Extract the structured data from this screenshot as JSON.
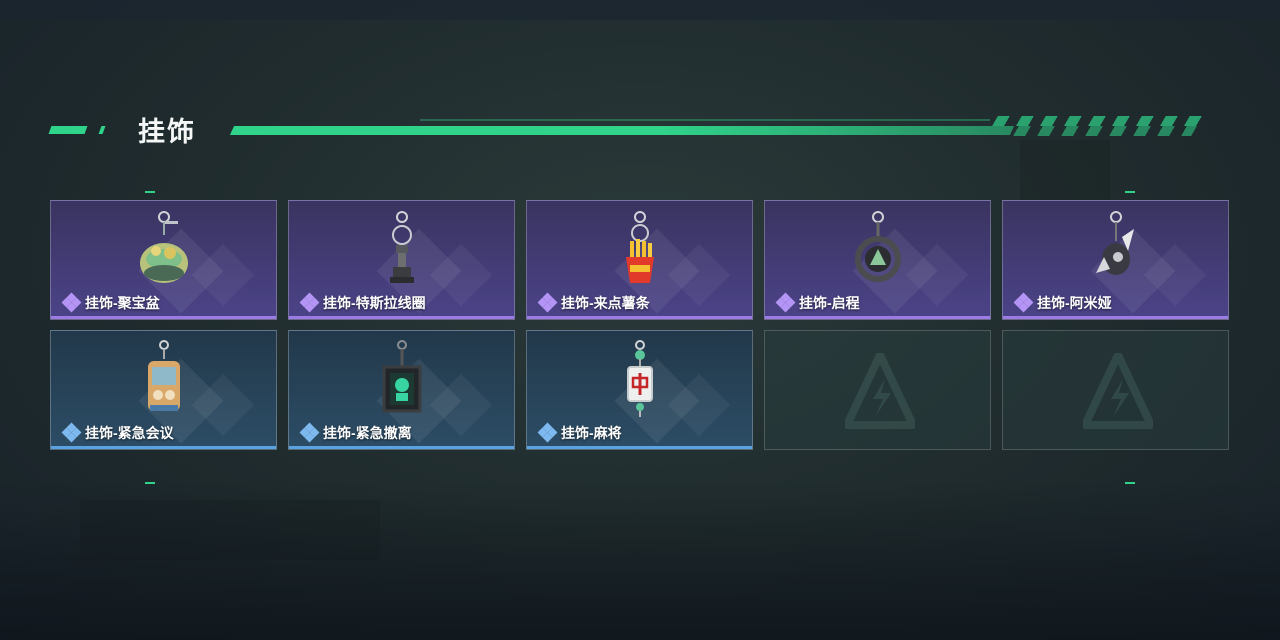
{
  "header": {
    "title": "挂饰"
  },
  "colors": {
    "accent": "#2fd48a",
    "purple_rarity": "#9b7be4",
    "blue_rarity": "#5aa3e0"
  },
  "items": [
    {
      "label": "挂饰-聚宝盆",
      "rarity": "purple",
      "icon": "treasure-bowl-charm-icon"
    },
    {
      "label": "挂饰-特斯拉线圈",
      "rarity": "purple",
      "icon": "tesla-coil-charm-icon"
    },
    {
      "label": "挂饰-来点薯条",
      "rarity": "purple",
      "icon": "fries-charm-icon"
    },
    {
      "label": "挂饰-启程",
      "rarity": "purple",
      "icon": "ring-charm-icon"
    },
    {
      "label": "挂饰-阿米娅",
      "rarity": "purple",
      "icon": "amiya-charm-icon"
    },
    {
      "label": "挂饰-紧急会议",
      "rarity": "blue",
      "icon": "emergency-meeting-charm-icon"
    },
    {
      "label": "挂饰-紧急撤离",
      "rarity": "blue",
      "icon": "emergency-evac-charm-icon"
    },
    {
      "label": "挂饰-麻将",
      "rarity": "blue",
      "icon": "mahjong-charm-icon"
    },
    {
      "label": "",
      "rarity": "empty",
      "icon": "empty-slot-logo-icon"
    },
    {
      "label": "",
      "rarity": "empty",
      "icon": "empty-slot-logo-icon"
    }
  ]
}
